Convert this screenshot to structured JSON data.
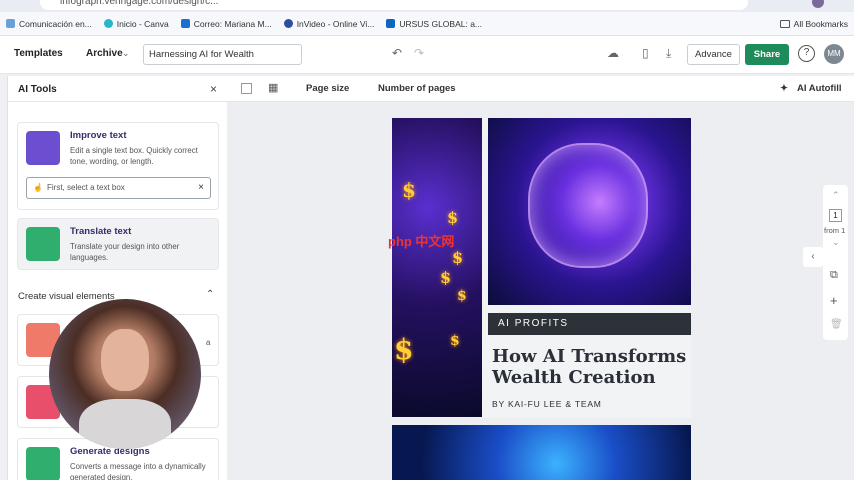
{
  "browser": {
    "url": "infograph.venngage.com/design/c...",
    "bookmarks": [
      {
        "label": "Comunicación en..."
      },
      {
        "label": "Inicio - Canva"
      },
      {
        "label": "Correo: Mariana M..."
      },
      {
        "label": "InVideo - Online Vi..."
      },
      {
        "label": "URSUS GLOBAL: a..."
      }
    ],
    "all_bookmarks": "All Bookmarks"
  },
  "header": {
    "templates": "Templates",
    "archive": "Archive",
    "document_title": "Harnessing AI for Wealth",
    "advance": "Advance",
    "share": "Share",
    "help": "?",
    "avatar": "MM"
  },
  "toolbar": {
    "page_size": "Page size",
    "number_of_pages": "Number of pages",
    "ai_autofill": "AI Autofill"
  },
  "ai_panel": {
    "title": "AI Tools",
    "improve": {
      "title": "Improve text",
      "desc": "Edit a single text box. Quickly correct tone, wording, or length.",
      "placeholder": "First, select a text box"
    },
    "translate": {
      "title": "Translate text",
      "desc": "Translate your design into other languages."
    },
    "section": "Create visual elements",
    "generate": {
      "title": "Generate designs",
      "desc": "Converts a message into a dynamically generated design."
    },
    "partial_a": "a"
  },
  "design": {
    "tag": "AI PROFITS",
    "headline": "How AI Transforms Wealth Creation",
    "byline": "BY KAI-FU LEE & TEAM"
  },
  "pager": {
    "current": "1",
    "from": "from 1"
  },
  "watermark": "php 中文网",
  "colors": {
    "share": "#1e8c5a",
    "accent_purple": "#3a2a6a"
  }
}
